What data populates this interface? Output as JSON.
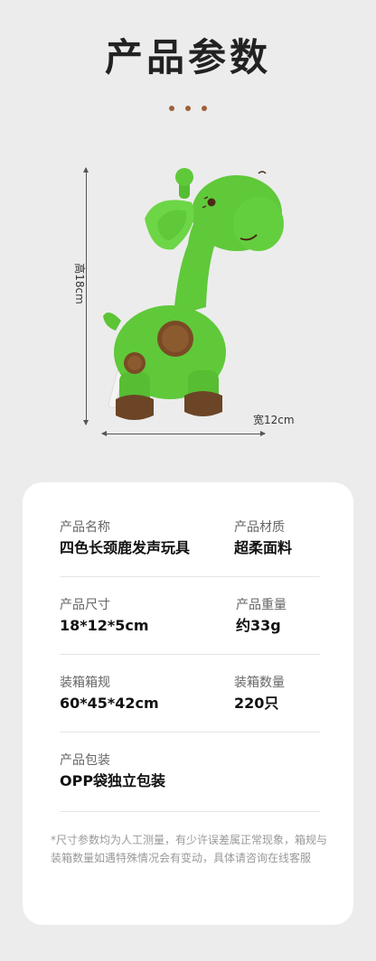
{
  "header": {
    "title": "产品参数"
  },
  "dimensions": {
    "height_label": "高18cm",
    "width_label": "宽12cm"
  },
  "specs": {
    "name": {
      "label": "产品名称",
      "value": "四色长颈鹿发声玩具"
    },
    "material": {
      "label": "产品材质",
      "value": "超柔面料"
    },
    "size": {
      "label": "产品尺寸",
      "value": "18*12*5cm"
    },
    "weight": {
      "label": "产品重量",
      "value": "约33g"
    },
    "carton_spec": {
      "label": "装箱箱规",
      "value": "60*45*42cm"
    },
    "carton_qty": {
      "label": "装箱数量",
      "value": "220只"
    },
    "packaging": {
      "label": "产品包装",
      "value": "OPP袋独立包装"
    }
  },
  "note": "*尺寸参数均为人工测量，有少许误差属正常现象，箱规与装箱数量如遇特殊情况会有变动，具体请咨询在线客服",
  "colors": {
    "accent": "#a0603a",
    "plush_green": "#5fc93a",
    "spot_brown": "#7a4a25"
  }
}
